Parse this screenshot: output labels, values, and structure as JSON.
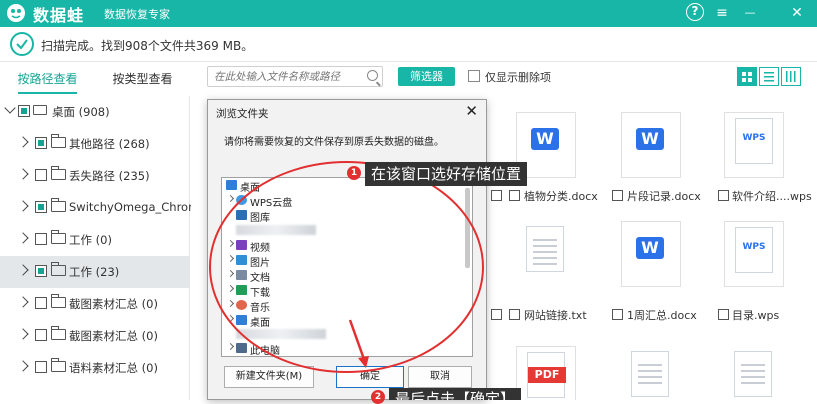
{
  "app": {
    "brand": "数据蛙",
    "subtitle": "数据恢复专家",
    "accent": "#17b6a6"
  },
  "window_controls": {
    "help": "?",
    "menu": "≡",
    "minimize": "—",
    "close": "✕"
  },
  "status": {
    "text": "扫描完成。找到908个文件共369 MB。"
  },
  "tabs": {
    "by_path": "按路径查看",
    "by_type": "按类型查看"
  },
  "toolbar": {
    "search_placeholder": "在此处输入文件名称或路径",
    "filter_label": "筛选器",
    "show_deleted_label": "仅显示删除项"
  },
  "sidebar": {
    "items": [
      {
        "label": "桌面 (908)"
      },
      {
        "label": "其他路径 (268)"
      },
      {
        "label": "丢失路径 (235)"
      },
      {
        "label": "SwitchyOmega_Chromium"
      },
      {
        "label": "工作 (0)"
      },
      {
        "label": "工作 (23)"
      },
      {
        "label": "截图素材汇总 (0)"
      },
      {
        "label": "截图素材汇总 (0)"
      },
      {
        "label": "语料素材汇总 (0)"
      }
    ]
  },
  "files": [
    {
      "type": "word",
      "badge": "W",
      "caption": "植物分类.docx"
    },
    {
      "type": "word",
      "badge": "W",
      "caption": "片段记录.docx"
    },
    {
      "type": "wps",
      "badge": "WPS",
      "caption": "软件介绍....wps"
    },
    {
      "type": "text",
      "badge": "",
      "caption": "网站链接.txt"
    },
    {
      "type": "word",
      "badge": "W",
      "caption": "1周汇总.docx"
    },
    {
      "type": "wps",
      "badge": "WPS",
      "caption": "目录.wps"
    },
    {
      "type": "pdf",
      "badge": "PDF",
      "caption": ""
    },
    {
      "type": "text",
      "badge": "",
      "caption": ""
    },
    {
      "type": "text",
      "badge": "",
      "caption": ""
    }
  ],
  "dialog": {
    "title": "浏览文件夹",
    "close": "✕",
    "message": "请你将需要恢复的文件保存到原丢失数据的磁盘。",
    "tree": [
      {
        "label": "桌面"
      },
      {
        "label": "WPS云盘"
      },
      {
        "label": "图库"
      },
      {
        "label": "视频"
      },
      {
        "label": "图片"
      },
      {
        "label": "文档"
      },
      {
        "label": "下载"
      },
      {
        "label": "音乐"
      },
      {
        "label": "桌面"
      },
      {
        "label": "此电脑"
      }
    ],
    "buttons": {
      "new_folder": "新建文件夹(M)",
      "ok": "确定",
      "cancel": "取消"
    }
  },
  "annotations": {
    "step1_number": "1",
    "step1_text": "在该窗口选好存储位置",
    "step2_number": "2",
    "step2_text": "最后点击【确定】"
  }
}
